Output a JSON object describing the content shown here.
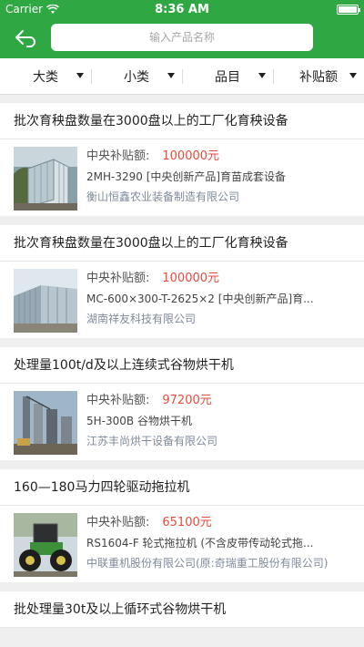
{
  "status": {
    "carrier": "Carrier",
    "time": "8:36 AM"
  },
  "search": {
    "placeholder": "输入产品名称"
  },
  "filters": [
    {
      "label": "大类"
    },
    {
      "label": "小类"
    },
    {
      "label": "品目"
    },
    {
      "label": "补贴额"
    }
  ],
  "subsidy_label": "中央补贴额:",
  "products": [
    {
      "title": "批次育秧盘数量在3000盘以上的工厂化育秧设备",
      "price": "100000元",
      "model": "2MH-3290 [中央创新产品]育苗成套设备",
      "company": "衡山恒鑫农业装备制造有限公司"
    },
    {
      "title": "批次育秧盘数量在3000盘以上的工厂化育秧设备",
      "price": "100000元",
      "model": "MC-600×300-T-2625×2 [中央创新产品]育...",
      "company": "湖南祥友科技有限公司"
    },
    {
      "title": "处理量100t/d及以上连续式谷物烘干机",
      "price": "97200元",
      "model": "5H-300B 谷物烘干机",
      "company": "江苏丰尚烘干设备有限公司"
    },
    {
      "title": "160—180马力四轮驱动拖拉机",
      "price": "65100元",
      "model": "RS1604-F 轮式拖拉机 (不含皮带传动轮式拖...",
      "company": "中联重机股份有限公司(原:奇瑞重工股份有限公司)"
    },
    {
      "title": "批处理量30t及以上循环式谷物烘干机"
    }
  ]
}
